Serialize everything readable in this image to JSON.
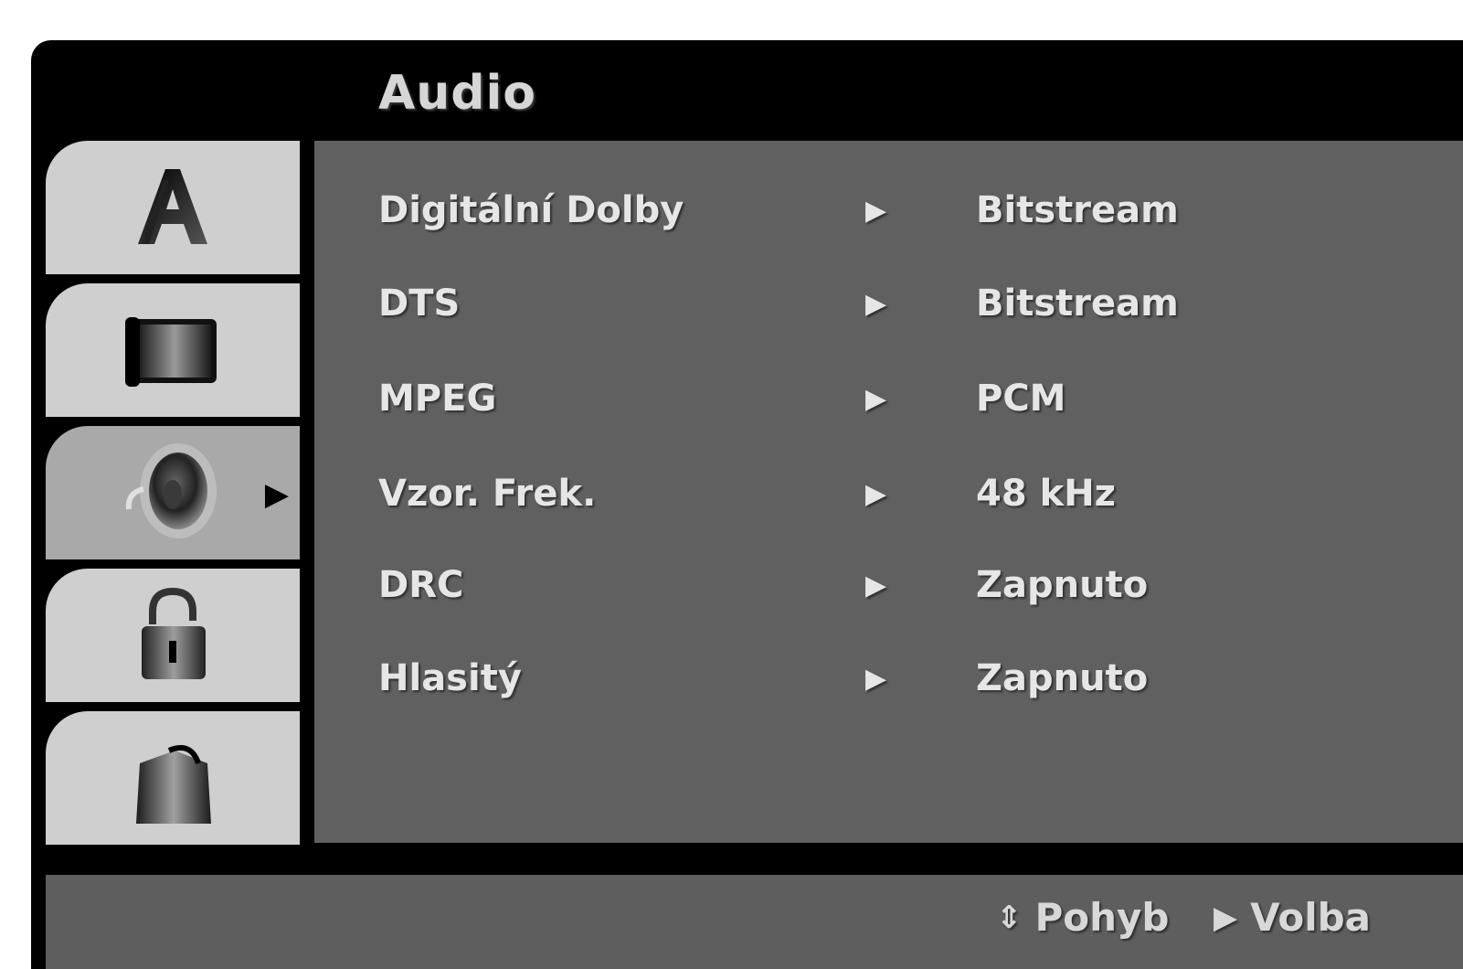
{
  "header": {
    "title": "Audio"
  },
  "tabs": [
    {
      "id": "language",
      "icon": "language-a-icon",
      "active": false
    },
    {
      "id": "display",
      "icon": "tv-screen-icon",
      "active": false
    },
    {
      "id": "audio",
      "icon": "speaker-icon",
      "active": true
    },
    {
      "id": "lock",
      "icon": "padlock-icon",
      "active": false
    },
    {
      "id": "others",
      "icon": "others-icon",
      "active": false
    }
  ],
  "active_pointer": "▶",
  "settings": [
    {
      "label": "Digitální Dolby",
      "arrow": "▶",
      "value": "Bitstream"
    },
    {
      "label": "DTS",
      "arrow": "▶",
      "value": "Bitstream"
    },
    {
      "label": "MPEG",
      "arrow": "▶",
      "value": "PCM"
    },
    {
      "label": "Vzor. Frek.",
      "arrow": "▶",
      "value": "48 kHz"
    },
    {
      "label": "DRC",
      "arrow": "▶",
      "value": "Zapnuto"
    },
    {
      "label": "Hlasitý",
      "arrow": "▶",
      "value": "Zapnuto"
    }
  ],
  "footer": {
    "move_glyph": "⇕",
    "move_label": "Pohyb",
    "select_glyph": "▶",
    "select_label": "Volba"
  },
  "colors": {
    "frame": "#000000",
    "panel": "#606060",
    "tab": "#cfcfcf",
    "tab_active": "#a9a9a9",
    "text": "#e6e6e6"
  }
}
